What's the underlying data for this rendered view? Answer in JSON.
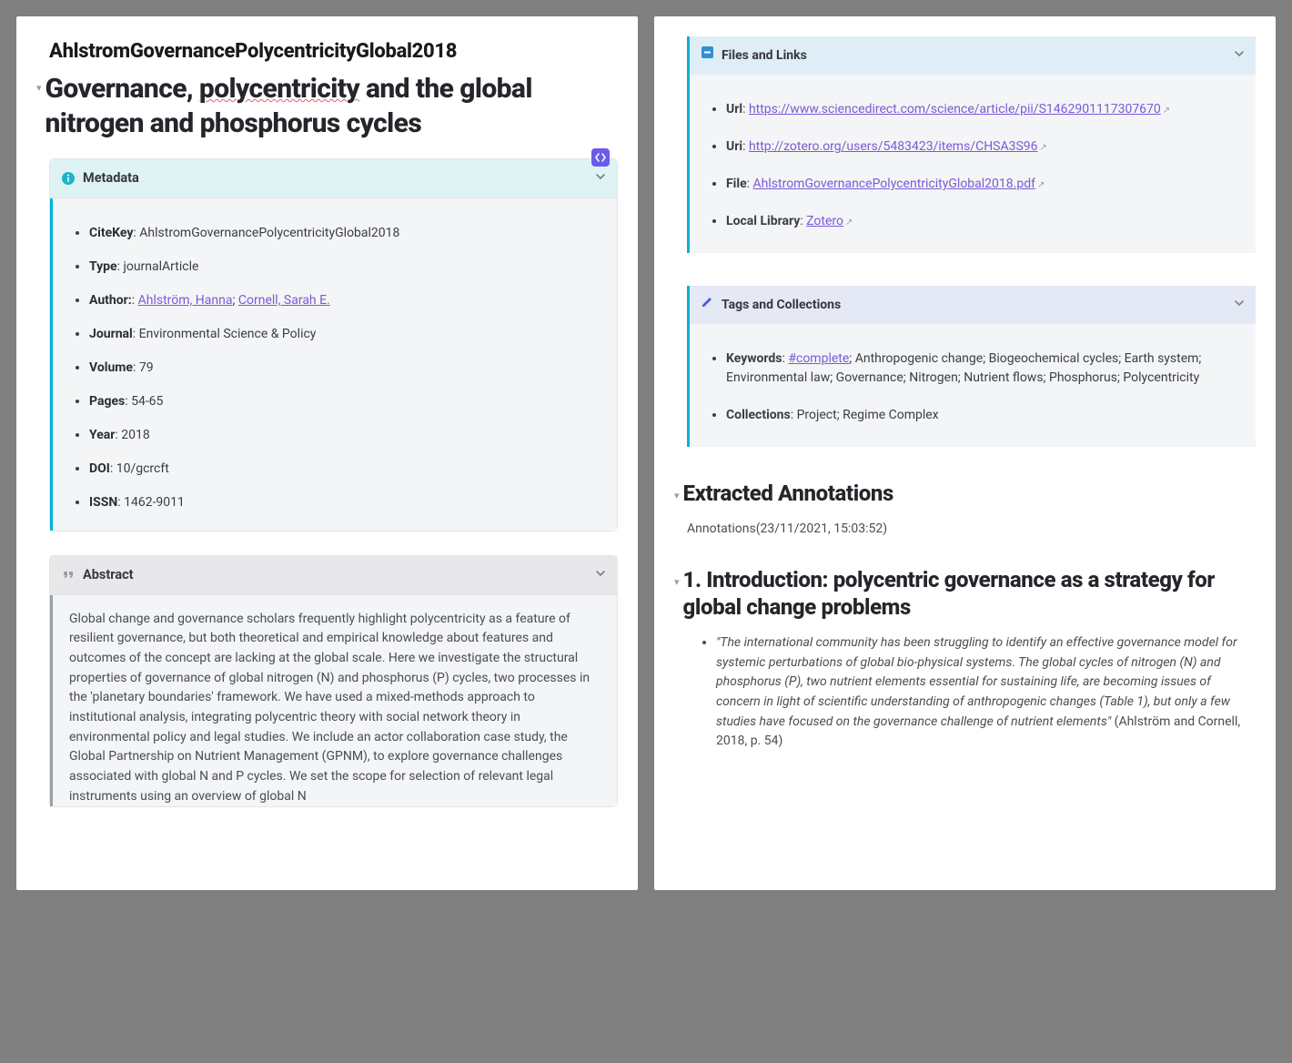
{
  "citekey": "AhlstromGovernancePolycentricityGlobal2018",
  "title_parts": {
    "pre": "Governance, ",
    "underlined": "polycentricity",
    "post": " and the global nitrogen and phosphorus cycles"
  },
  "metadata": {
    "header": "Metadata",
    "items": {
      "citekey_label": "CiteKey",
      "citekey_value": "AhlstromGovernancePolycentricityGlobal2018",
      "type_label": "Type",
      "type_value": "journalArticle",
      "author_label": "Author:",
      "authors": [
        "Ahlström, Hanna",
        "Cornell, Sarah E."
      ],
      "journal_label": "Journal",
      "journal_value": "Environmental Science & Policy",
      "volume_label": "Volume",
      "volume_value": "79",
      "pages_label": "Pages",
      "pages_value": "54-65",
      "year_label": "Year",
      "year_value": "2018",
      "doi_label": "DOI",
      "doi_value": "10/gcrcft",
      "issn_label": "ISSN",
      "issn_value": "1462-9011"
    }
  },
  "abstract": {
    "header": "Abstract",
    "text": "Global change and governance scholars frequently highlight polycentricity as a feature of resilient governance, but both theoretical and empirical knowledge about features and outcomes of the concept are lacking at the global scale. Here we investigate the structural properties of governance of global nitrogen (N) and phosphorus (P) cycles, two processes in the 'planetary boundaries' framework. We have used a mixed-methods approach to institutional analysis, integrating polycentric theory with social network theory in environmental policy and legal studies. We include an actor collaboration case study, the Global Partnership on Nutrient Management (GPNM), to explore governance challenges associated with global N and P cycles. We set the scope for selection of relevant legal instruments using an overview of global N"
  },
  "files": {
    "header": "Files and Links",
    "url_label": "Url",
    "url_value": "https://www.sciencedirect.com/science/article/pii/S1462901117307670",
    "uri_label": "Uri",
    "uri_value": "http://zotero.org/users/5483423/items/CHSA3S96",
    "file_label": "File",
    "file_value": "AhlstromGovernancePolycentricityGlobal2018.pdf",
    "local_label": "Local Library",
    "local_value": "Zotero"
  },
  "tags": {
    "header": "Tags and Collections",
    "keywords_label": "Keywords",
    "keywords_link": "#complete",
    "keywords_rest": "; Anthropogenic change; Biogeochemical cycles; Earth system; Environmental law; Governance; Nitrogen; Nutrient flows; Phosphorus; Polycentricity",
    "collections_label": "Collections",
    "collections_value": "Project; Regime Complex"
  },
  "annotations": {
    "heading": "Extracted Annotations",
    "line": "Annotations(23/11/2021, 15:03:52)",
    "section_heading": "1. Introduction: polycentric governance as a strategy for global change problems",
    "quote": "\"The international community has been struggling to identify an effective governance model for systemic perturbations of global bio-physical systems. The global cycles of nitrogen (N) and phosphorus (P), two nutrient elements essential for sustaining life, are becoming issues of concern in light of scientific understanding of anthropogenic changes (Table 1), but only a few studies have focused on the governance challenge of nutrient elements\"",
    "attribution": " (Ahlström and Cornell, 2018, p. 54)"
  }
}
